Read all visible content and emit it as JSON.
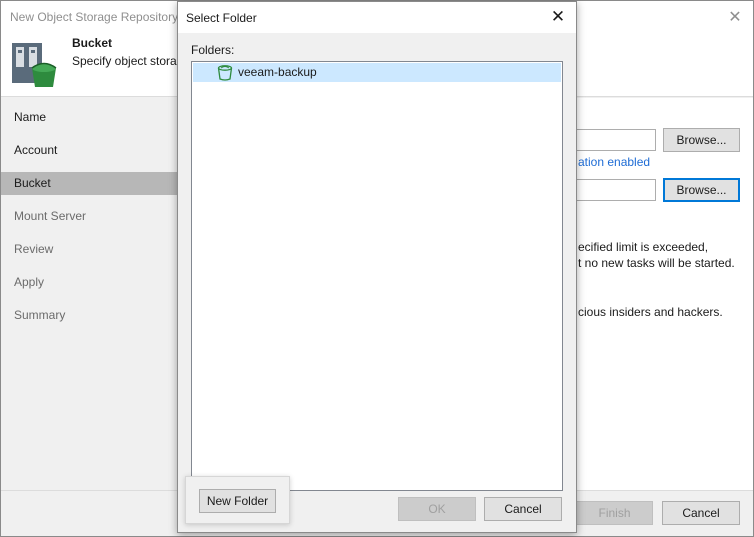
{
  "wizard": {
    "title": "New Object Storage Repository",
    "close_glyph": "✕",
    "header": {
      "title": "Bucket",
      "subtitle": "Specify object storag",
      "icon": "bucket-icon"
    },
    "steps": [
      {
        "label": "Name",
        "state": "done"
      },
      {
        "label": "Account",
        "state": "done"
      },
      {
        "label": "Bucket",
        "state": "active"
      },
      {
        "label": "Mount Server",
        "state": "pending"
      },
      {
        "label": "Review",
        "state": "pending"
      },
      {
        "label": "Apply",
        "state": "pending"
      },
      {
        "label": "Summary",
        "state": "pending"
      }
    ],
    "content": {
      "browse_label_1": "Browse...",
      "browse_label_2": "Browse...",
      "link_text": "ation enabled",
      "text_line_1": "ecified limit is exceeded,",
      "text_line_2": "t no new tasks will be started.",
      "text_line_3": "cious insiders and hackers."
    },
    "footer": {
      "finish_label": "Finish",
      "cancel_label": "Cancel"
    }
  },
  "dialog": {
    "title": "Select Folder",
    "close_glyph": "✕",
    "folders_label": "Folders:",
    "folders": [
      {
        "name": "veeam-backup",
        "selected": true,
        "icon": "bucket-icon"
      }
    ],
    "new_folder_label": "New Folder",
    "ok_label": "OK",
    "cancel_label": "Cancel"
  },
  "colors": {
    "accent": "#0078d7",
    "selection": "#cce8ff",
    "link": "#1e6cd5",
    "bucket_green": "#2e8b3e"
  }
}
